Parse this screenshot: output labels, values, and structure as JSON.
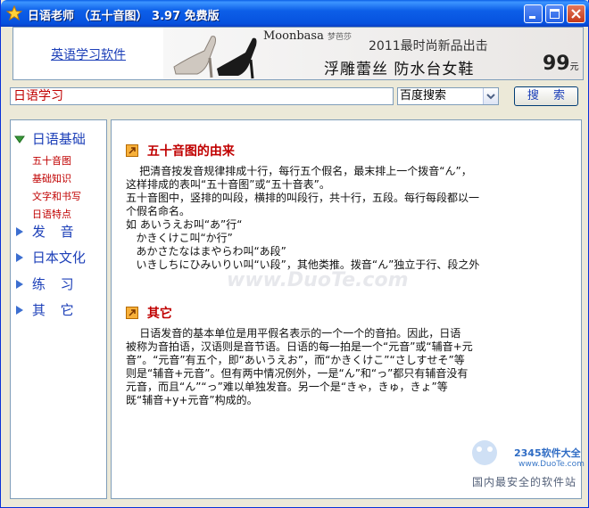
{
  "window": {
    "title": "日语老师 （五十音图） 3.97 免费版",
    "controls": [
      "minimize-icon",
      "maximize-icon",
      "close-icon"
    ]
  },
  "banner": {
    "link_text": "英语学习软件",
    "ad": {
      "brand": "Moonbasa",
      "brand_cn": "梦芭莎",
      "line1": "2011最时尚新品出击",
      "line2": "浮雕蕾丝  防水台女鞋",
      "price": "99",
      "price_unit": "元"
    }
  },
  "search": {
    "value": "日语学习",
    "engine": "百度搜索",
    "button": "搜 索"
  },
  "sidebar": {
    "items": [
      {
        "label": "日语基础",
        "expanded": true,
        "sub": [
          "五十音图",
          "基础知识",
          "文字和书写",
          "日语特点"
        ]
      },
      {
        "label": "发  音"
      },
      {
        "label": "日本文化"
      },
      {
        "label": "练  习"
      },
      {
        "label": "其  它"
      }
    ]
  },
  "content": {
    "sections": [
      {
        "title": "五十音图的由来",
        "lines": [
          "    把清音按发音规律排成十行，每行五个假名，最末排上一个拨音“ん”，",
          "这样排成的表叫“五十音图”或“五十音表”。",
          "五十音图中，竖排的叫段，横排的叫段行，共十行，五段。每行每段都以一",
          "个假名命名。",
          "如 あいうえお叫“あ”行“",
          "   かきくけこ叫“か行”",
          "   あかさたなはまやらわ叫“あ段”",
          "   いきしちにひみいりい叫“い段”，其他类推。拨音“ん”独立于行、段之外"
        ]
      },
      {
        "title": "其它",
        "lines": [
          "    日语发音的基本单位是用平假名表示的一个一个的音拍。因此，日语",
          "被称为音拍语，汉语则是音节语。日语的每一拍是一个“元音”或“辅音+元",
          "音”。“元音”有五个，即“あいうえお”，而“かきくけこ”“さしすせそ”等",
          "则是“辅音+元音”。但有两中情况例外，一是“ん”和“っ”都只有辅音没有",
          "元音，而且“ん”“っ”难以单独发音。另一个是“きゃ，きゅ，きょ”等",
          "既“辅音+y+元音”构成的。"
        ]
      }
    ]
  },
  "watermark": {
    "site": "2345软件大全",
    "url": "www.DuoTe.com",
    "slogan": "国内最安全的软件站",
    "center": "www.DuoTe.com"
  }
}
